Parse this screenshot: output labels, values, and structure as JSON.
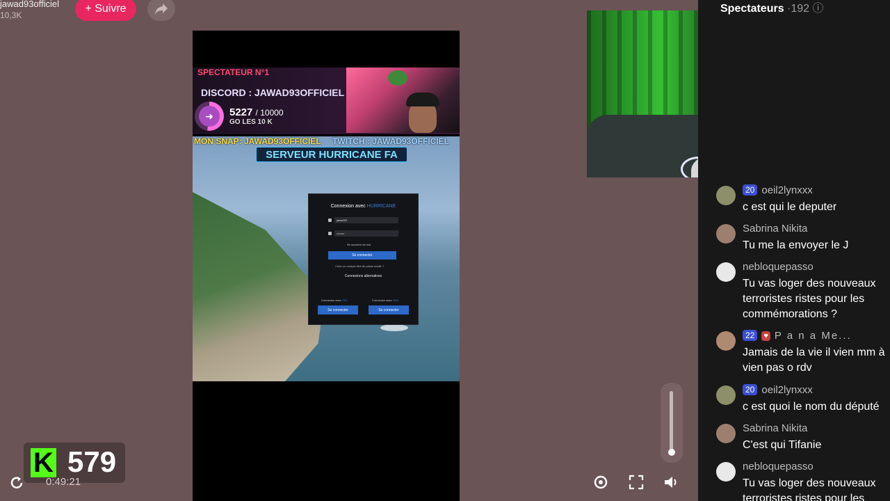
{
  "channel": {
    "handle": "jawad93officiel",
    "followers": "10,3K",
    "follow_label": "+ Suivre"
  },
  "stream_overlay": {
    "spectator_no1": "SPECTATEUR N°1",
    "discord": "DISCORD : JAWAD93OFFICIEL",
    "goal_current": "5227",
    "goal_total": "/ 10000",
    "goal_text": "GO LES 10 K",
    "goal_progress_fraction": 0.5227,
    "snap": "MON SNAP: JAWAD93OFFICIEL",
    "twitch": "TWITCH : JAWAD93OFFICIEL",
    "server": "SERVEUR HURRICANE FA"
  },
  "login_dialog": {
    "title": "Connexion avec",
    "brand": "HURRICANE",
    "username_value": "jawad93",
    "password_value": "••••••••",
    "remember_label": "Se souvenir de moi",
    "connect_label": "Se connecter",
    "links": "Créer un compte    Mot de passe oublié ?",
    "alt_title": "Connexions alternatives",
    "alt_left_label": "Connexion avec",
    "alt_left_brand": "CFX",
    "alt_right_label": "Connexion avec",
    "alt_right_brand": "SSO",
    "alt_button_label": "Se connecter"
  },
  "kick_counter": {
    "logo": "K",
    "count": "579",
    "elapsed": "0:49:21"
  },
  "volume": {
    "level_fraction": 0.1
  },
  "chat": {
    "title": "Spectateurs",
    "viewer_count": "·192",
    "messages": [
      {
        "user": "oeil2lynxxx",
        "badge": "20",
        "text": "c est qui le deputer"
      },
      {
        "user": "Sabrina Nikita",
        "text": "Tu me la envoyer le J"
      },
      {
        "user": "nebloquepasso",
        "text": "Tu vas loger des nouveaux terroristes ristes pour les commémorations ?"
      },
      {
        "user": "P a n a Me...",
        "badge": "22",
        "text": "Jamais de la vie il vien mm à vien pas o rdv"
      },
      {
        "user": "oeil2lynxxx",
        "badge": "20",
        "text": "c est quoi le nom du député"
      },
      {
        "user": "Sabrina Nikita",
        "text": "C'est qui Tifanie"
      },
      {
        "user": "nebloquepasso",
        "text": "Tu vas loger des nouveaux terroristes ristes pour les"
      }
    ]
  },
  "colors": {
    "page_bg": "#6b5456",
    "follow_button": "#e8265f",
    "kick_green": "#53fc18",
    "chat_bg": "#181818",
    "badge_blue": "#3b4fd0"
  }
}
